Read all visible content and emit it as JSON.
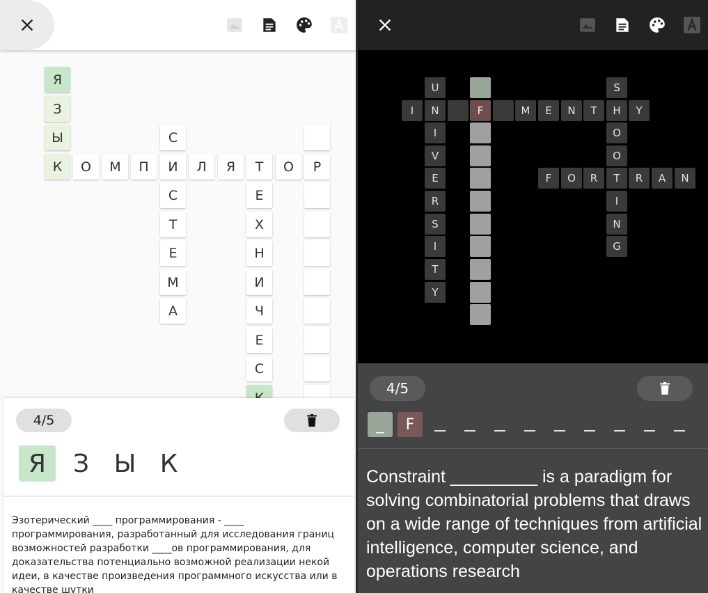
{
  "left": {
    "counter": "4/5",
    "answer_letters": [
      "Я",
      "З",
      "Ы",
      "К"
    ],
    "clue": "Эзотерический ____ программирования - ____ программирования, разработанный для исследования границ возможностей разработки ____ов программирования, для доказательства потенциально возможной реализации некой идеи, в качестве произведения программного искусства или в качестве шутки",
    "grid_letters": {
      "ya": "Я",
      "z": "З",
      "y": "Ы",
      "k": "К",
      "c1": "О",
      "c2": "М",
      "c3": "П",
      "c4": "И",
      "c5": "Л",
      "c6": "Я",
      "c7": "Т",
      "c8": "О",
      "c9": "Р",
      "s1": "С",
      "s2": "С",
      "s3": "Т",
      "s4": "Е",
      "s5": "М",
      "s6": "А",
      "t1": "Е",
      "t2": "Х",
      "t3": "Н",
      "t4": "И",
      "t5": "Ч",
      "t6": "Е",
      "t7": "С",
      "t8": "К"
    }
  },
  "right": {
    "counter": "4/5",
    "answer": [
      "_",
      "F"
    ],
    "clue": "Constraint _________ is a paradigm for solving combinatorial problems that draws on a wide range of techniques from artificial intelligence, computer science, and operations research",
    "grid_letters": {
      "u1": "U",
      "u2": "N",
      "u3": "I",
      "u4": "V",
      "u5": "E",
      "u6": "R",
      "u7": "S",
      "u8": "I",
      "u9": "T",
      "u10": "Y",
      "i1": "I",
      "f1": "F",
      "m1": "M",
      "m2": "E",
      "m3": "N",
      "m4": "T",
      "m5": "H",
      "m6": "Y",
      "sh1": "S",
      "sh2": "O",
      "sh3": "O",
      "sh4": "T",
      "sh5": "I",
      "sh6": "N",
      "sh7": "G",
      "fo1": "F",
      "fo2": "O",
      "fo3": "R",
      "fo4": "R",
      "fo5": "A",
      "fo6": "N"
    }
  },
  "colors": {
    "active_green": "#c8e6c9",
    "highlight_green": "#eaf3e0",
    "dark_bg": "#000000",
    "dark_panel": "#444444"
  },
  "icons": [
    "close-icon",
    "image-icon",
    "document-icon",
    "palette-icon",
    "font-icon",
    "trash-icon"
  ]
}
